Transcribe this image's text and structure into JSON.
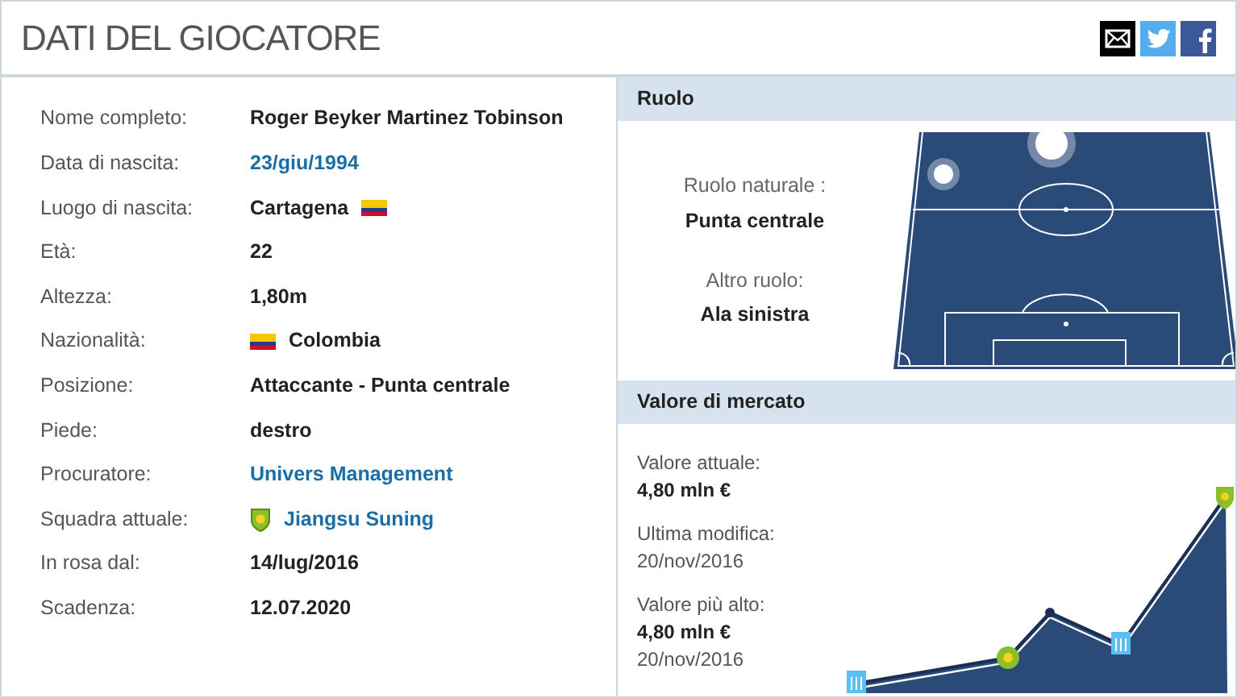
{
  "header": {
    "title": "DATI DEL GIOCATORE",
    "share": [
      {
        "kind": "email"
      },
      {
        "kind": "twitter"
      },
      {
        "kind": "facebook"
      }
    ]
  },
  "details": [
    {
      "label": "Nome completo:",
      "value": "Roger Beyker Martinez Tobinson",
      "kind": "text"
    },
    {
      "label": "Data di nascita:",
      "value": "23/giu/1994",
      "kind": "link"
    },
    {
      "label": "Luogo di nascita:",
      "value": "Cartagena",
      "kind": "flag_after"
    },
    {
      "label": "Età:",
      "value": "22",
      "kind": "text"
    },
    {
      "label": "Altezza:",
      "value": "1,80m",
      "kind": "text"
    },
    {
      "label": "Nazionalità:",
      "value": "Colombia",
      "kind": "flag_before"
    },
    {
      "label": "Posizione:",
      "value": "Attaccante - Punta centrale",
      "kind": "text"
    },
    {
      "label": "Piede:",
      "value": "destro",
      "kind": "text"
    },
    {
      "label": "Procuratore:",
      "value": "Univers Management",
      "kind": "link"
    },
    {
      "label": "Squadra attuale:",
      "value": "Jiangsu Suning",
      "kind": "club_link"
    },
    {
      "label": "In rosa dal:",
      "value": "14/lug/2016",
      "kind": "text"
    },
    {
      "label": "Scadenza:",
      "value": "12.07.2020",
      "kind": "text"
    }
  ],
  "role": {
    "title": "Ruolo",
    "natural_label": "Ruolo naturale :",
    "natural_value": "Punta centrale",
    "other_label": "Altro ruolo:",
    "other_value": "Ala sinistra"
  },
  "market": {
    "title": "Valore di mercato",
    "current_label": "Valore attuale:",
    "current_value": "4,80 mln €",
    "updated_label": "Ultima modifica:",
    "updated_date": "20/nov/2016",
    "highest_label": "Valore più alto:",
    "highest_value": "4,80 mln €",
    "highest_date": "20/nov/2016"
  }
}
